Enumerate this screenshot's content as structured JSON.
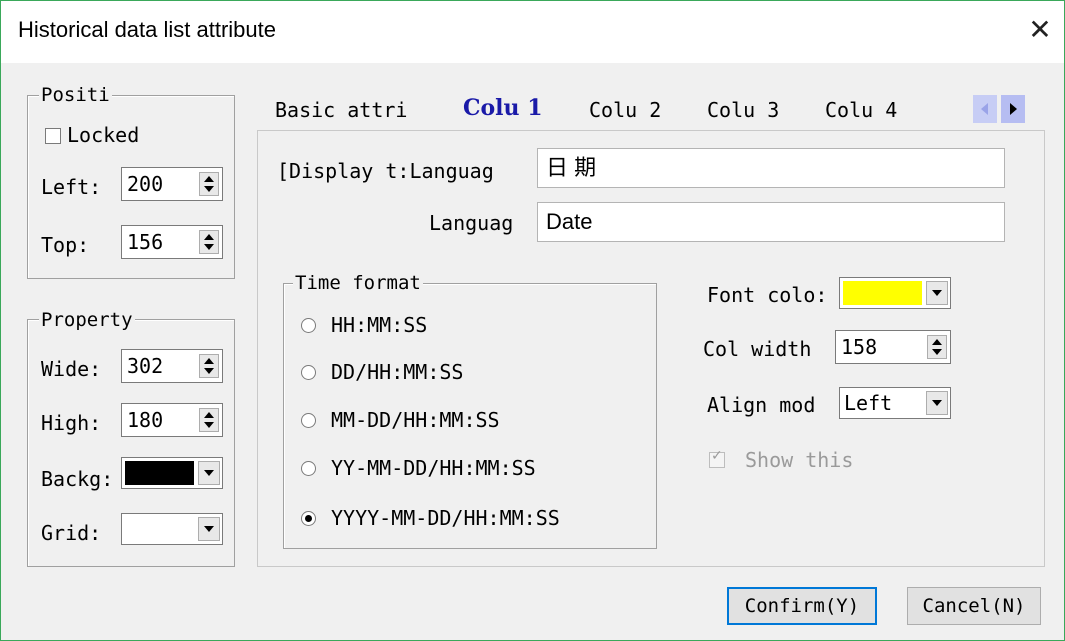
{
  "window": {
    "title": "Historical data list attribute",
    "close_icon": "close-icon"
  },
  "position": {
    "legend": "Positi",
    "locked_label": "Locked",
    "locked_checked": false,
    "left_label": "Left:",
    "left_value": "200",
    "top_label": "Top:",
    "top_value": "156"
  },
  "property": {
    "legend": "Property",
    "wide_label": "Wide:",
    "wide_value": "302",
    "high_label": "High:",
    "high_value": "180",
    "backg_label": "Backg:",
    "backg_color": "#000000",
    "grid_label": "Grid:",
    "grid_color": "#ffffff"
  },
  "tabs": [
    {
      "label": "Basic attri",
      "active": false
    },
    {
      "label": "Colu 1",
      "active": true
    },
    {
      "label": "Colu 2",
      "active": false
    },
    {
      "label": "Colu 3",
      "active": false
    },
    {
      "label": "Colu 4",
      "active": false
    }
  ],
  "column": {
    "display_label": "[Display t:Languag",
    "language1_value": "日 期",
    "language2_label": "Languag",
    "language2_value": "Date",
    "time_format": {
      "legend": "Time format",
      "options": [
        "HH:MM:SS",
        "DD/HH:MM:SS",
        "MM-DD/HH:MM:SS",
        "YY-MM-DD/HH:MM:SS",
        "YYYY-MM-DD/HH:MM:SS"
      ],
      "selected_index": 4
    },
    "font_color_label": "Font colo:",
    "font_color": "#ffff00",
    "col_width_label": "Col width",
    "col_width_value": "158",
    "align_mode_label": "Align mod",
    "align_mode_value": "Left",
    "show_this_label": "Show this",
    "show_this_checked": true
  },
  "buttons": {
    "confirm": "Confirm(Y)",
    "cancel": "Cancel(N)"
  },
  "colors": {
    "active_tab": "#1a1aa8",
    "default_button_border": "#0078d7",
    "window_border": "#3aa85a"
  }
}
